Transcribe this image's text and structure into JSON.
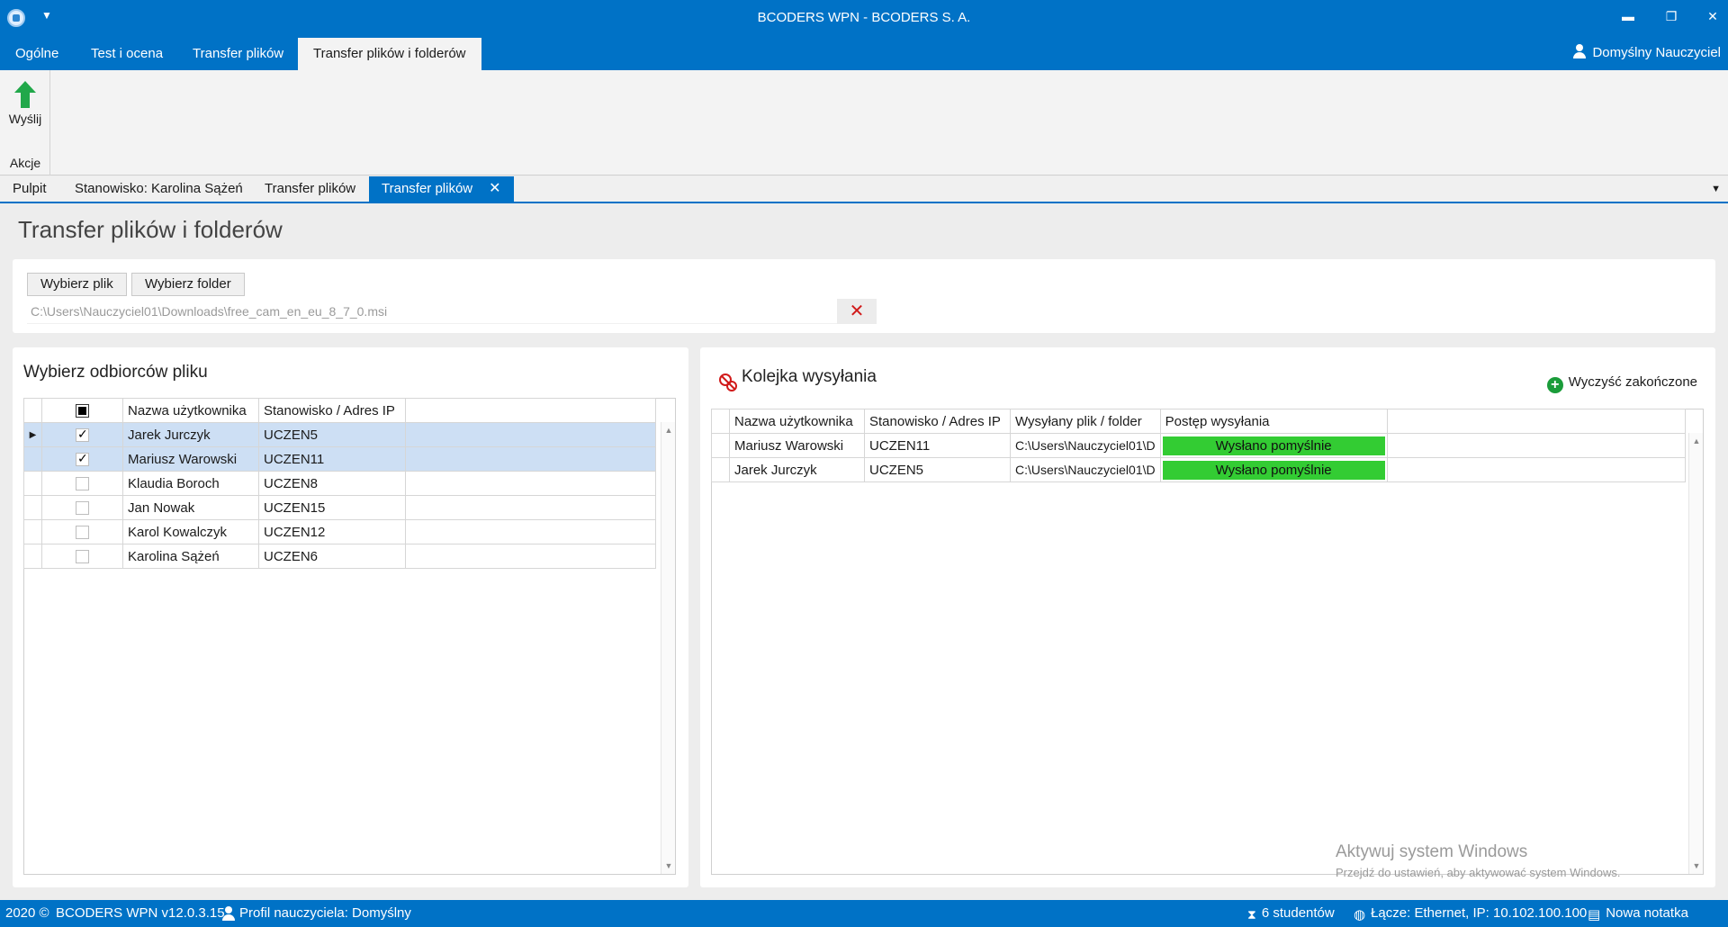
{
  "window": {
    "title": "BCODERS WPN - BCODERS S. A.",
    "controls": [
      "minimize",
      "restore",
      "close"
    ]
  },
  "ribbon": {
    "tabs": [
      "Ogólne",
      "Test i ocena",
      "Transfer plików",
      "Transfer plików i folderów"
    ],
    "active_tab": "Transfer plików i folderów",
    "user": "Domyślny Nauczyciel",
    "send_label": "Wyślij",
    "group_label": "Akcje"
  },
  "doc_tabs": [
    "Pulpit",
    "Stanowisko: Karolina Sążeń",
    "Transfer plików",
    "Transfer plików"
  ],
  "page": {
    "title": "Transfer plików i folderów",
    "choose_file": "Wybierz plik",
    "choose_folder": "Wybierz folder",
    "file_path": "C:\\Users\\Nauczyciel01\\Downloads\\free_cam_en_eu_8_7_0.msi"
  },
  "recipients": {
    "title": "Wybierz odbiorców pliku",
    "columns": [
      "Nazwa użytkownika",
      "Stanowisko / Adres IP"
    ],
    "rows": [
      {
        "name": "Jarek Jurczyk",
        "station": "UCZEN5",
        "checked": true,
        "selected": true,
        "current": true
      },
      {
        "name": "Mariusz Warowski",
        "station": "UCZEN11",
        "checked": true,
        "selected": true,
        "current": false
      },
      {
        "name": "Klaudia Boroch",
        "station": "UCZEN8",
        "checked": false,
        "selected": false,
        "current": false
      },
      {
        "name": "Jan Nowak",
        "station": "UCZEN15",
        "checked": false,
        "selected": false,
        "current": false
      },
      {
        "name": "Karol Kowalczyk",
        "station": "UCZEN12",
        "checked": false,
        "selected": false,
        "current": false
      },
      {
        "name": "Karolina Sążeń",
        "station": "UCZEN6",
        "checked": false,
        "selected": false,
        "current": false
      }
    ]
  },
  "queue": {
    "title": "Kolejka wysyłania",
    "clear_label": "Wyczyść zakończone",
    "columns": [
      "Nazwa użytkownika",
      "Stanowisko / Adres IP",
      "Wysyłany plik / folder",
      "Postęp wysyłania"
    ],
    "rows": [
      {
        "name": "Mariusz Warowski",
        "station": "UCZEN11",
        "file": "C:\\Users\\Nauczyciel01\\D",
        "status": "Wysłano pomyślnie",
        "progress": 1.0
      },
      {
        "name": "Jarek Jurczyk",
        "station": "UCZEN5",
        "file": "C:\\Users\\Nauczyciel01\\D",
        "status": "Wysłano pomyślnie",
        "progress": 1.0
      }
    ],
    "progress_color": "#33cc33"
  },
  "watermark": {
    "line1": "Aktywuj system Windows",
    "line2": "Przejdź do ustawień, aby aktywować system Windows."
  },
  "statusbar": {
    "copyright": "2020 ©",
    "version": "BCODERS WPN v12.0.3.15",
    "profile": "Profil nauczyciela: Domyślny",
    "students": "6 studentów",
    "connection": "Łącze: Ethernet, IP: 10.102.100.100",
    "note": "Nowa notatka"
  },
  "colors": {
    "accent": "#0072c6",
    "selected_row": "#cddff4",
    "send_arrow": "#21a84a",
    "clear_x": "#d11a1a"
  }
}
